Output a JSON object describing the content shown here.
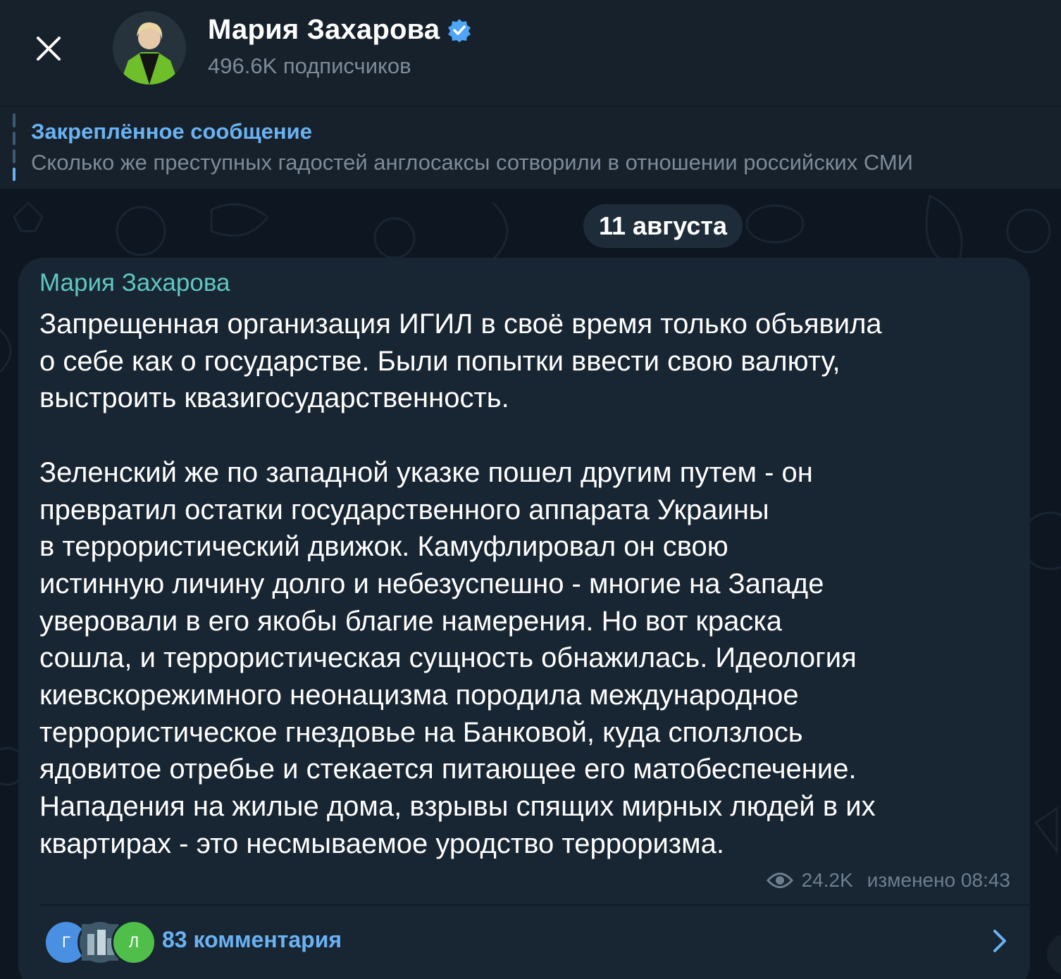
{
  "header": {
    "channel_name": "Мария Захарова",
    "subscribers": "496.6K подписчиков",
    "icons": {
      "close": "close-icon",
      "verified": "verified-badge-icon"
    }
  },
  "pinned": {
    "title": "Закреплённое сообщение",
    "text": "Сколько же преступных гадостей англосаксы сотворили в отношении российских СМИ"
  },
  "chat": {
    "date": "11 августа",
    "message": {
      "sender": "Мария Захарова",
      "text": "Запрещенная организация ИГИЛ в своё время только объявила\nо себе как о государстве. Были попытки ввести свою валюту,\nвыстроить квазигосударственность.\n\nЗеленский же по западной указке пошел другим путем - он\nпревратил остатки государственного аппарата Украины\nв террористический движок. Камуфлировал он свою\nистинную личину долго и небезуспешно - многие на Западе\nуверовали в его якобы благие намерения. Но вот краска\nсошла, и террористическая сущность обнажилась. Идеология\nкиевскорежимного неонацизма породила международное\nтеррористическое гнездовье на Банковой, куда сползлось\nядовитое отребье и стекается питающее его матобеспечение.\nНападения на жилые дома, взрывы спящих мирных людей в их\nквартирах - это несмываемое уродство терроризма.",
      "views": "24.2K",
      "edited": "изменено 08:43"
    },
    "comments": {
      "label": "83 комментария",
      "avatars": [
        {
          "letter": "Г",
          "color": "#4a90e2"
        },
        {
          "letter": "",
          "color": "#3c5a6e"
        },
        {
          "letter": "Л",
          "color": "#4fbf4a"
        }
      ]
    }
  },
  "colors": {
    "background": "#0e1621",
    "header": "#17212b",
    "bubble": "#182533",
    "accent": "#6ab2f2",
    "sender": "#5fc8c0",
    "muted": "#7d8b99"
  }
}
